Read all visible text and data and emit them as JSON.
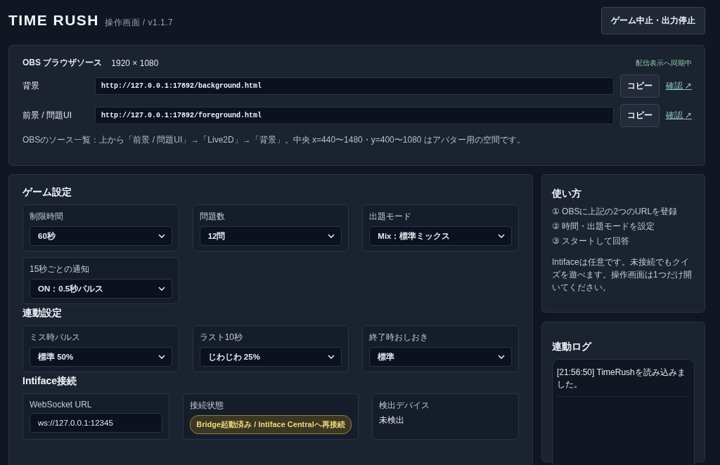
{
  "header": {
    "title": "TIME RUSH",
    "subtitle": "操作画面 / v1.1.7",
    "stop_button": "ゲーム中止・出力停止"
  },
  "obs": {
    "title": "OBS ブラウザソース",
    "resolution": "1920 × 1080",
    "sync_status": "配信表示へ同期中",
    "sources": [
      {
        "label": "背景",
        "url": "http://127.0.0.1:17892/background.html",
        "copy": "コピー",
        "open": "確認 ↗"
      },
      {
        "label": "前景 / 問題UI",
        "url": "http://127.0.0.1:17892/foreground.html",
        "copy": "コピー",
        "open": "確認 ↗"
      }
    ],
    "note": "OBSのソース一覧：上から「前景 / 問題UI」→「Live2D」→「背景」。中央 x=440〜1480・y=400〜1080 はアバター用の空間です。"
  },
  "sections": [
    {
      "title": "ゲーム設定",
      "fields": [
        {
          "kind": "select",
          "label": "制限時間",
          "value": "60秒"
        },
        {
          "kind": "select",
          "label": "問題数",
          "value": "12問"
        },
        {
          "kind": "select",
          "label": "出題モード",
          "value": "Mix：標準ミックス"
        },
        {
          "kind": "select",
          "label": "15秒ごとの通知",
          "value": "ON：0.5秒パルス"
        }
      ]
    },
    {
      "title": "連動設定",
      "fields": [
        {
          "kind": "select",
          "label": "ミス時パルス",
          "value": "標準 50%"
        },
        {
          "kind": "select",
          "label": "ラスト10秒",
          "value": "じわじわ 25%"
        },
        {
          "kind": "select",
          "label": "終了時おしおき",
          "value": "標準"
        }
      ]
    },
    {
      "title": "Intiface接続",
      "fields": [
        {
          "kind": "input",
          "label": "WebSocket URL",
          "value": "ws://127.0.0.1:12345"
        },
        {
          "kind": "status",
          "label": "接続状態",
          "value": "Bridge起動済み / Intiface Centralへ再接続"
        },
        {
          "kind": "text",
          "label": "検出デバイス",
          "value": "未検出"
        }
      ]
    }
  ],
  "usage": {
    "title": "使い方",
    "steps": [
      "① OBSに上記の2つのURLを登録",
      "② 時間・出題モードを設定",
      "③ スタートして回答"
    ],
    "note": "Intifaceは任意です。未接続でもクイズを遊べます。操作画面は1つだけ開いてください。"
  },
  "log": {
    "title": "連動ログ",
    "entries": [
      "[21:56:50] TimeRushを読み込みました。"
    ]
  }
}
